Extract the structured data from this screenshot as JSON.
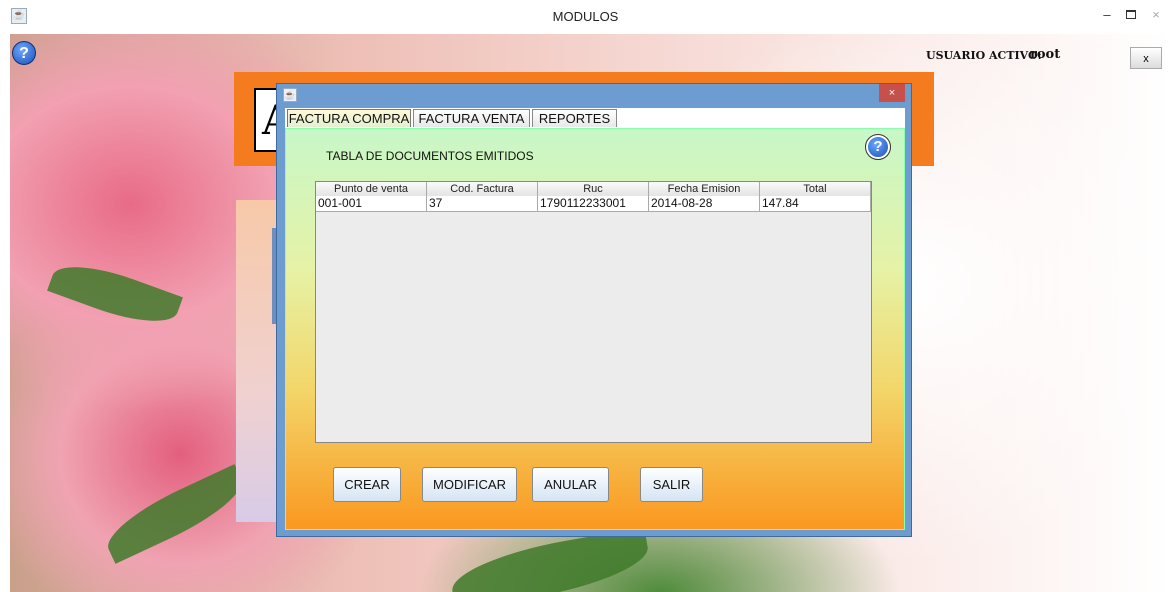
{
  "window": {
    "title": "MODULOS",
    "minimize": "–",
    "close": "×"
  },
  "header": {
    "user_label": "USUARIO ACTIVO:",
    "user_value": "root",
    "x_button": "x",
    "help": "?"
  },
  "logo_letter": "A",
  "dialog": {
    "close": "×",
    "tabs": [
      {
        "label": "FACTURA COMPRA",
        "active": true
      },
      {
        "label": "FACTURA VENTA",
        "active": false
      },
      {
        "label": "REPORTES",
        "active": false
      }
    ],
    "section_title": "TABLA DE DOCUMENTOS EMITIDOS",
    "help": "?",
    "table": {
      "columns": [
        "Punto de venta",
        "Cod. Factura",
        "Ruc",
        "Fecha Emision",
        "Total"
      ],
      "rows": [
        [
          "001-001",
          "37",
          "1790112233001",
          "2014-08-28",
          "147.84"
        ]
      ]
    },
    "buttons": {
      "crear": "CREAR",
      "modificar": "MODIFICAR",
      "anular": "ANULAR",
      "salir": "SALIR"
    }
  },
  "colors": {
    "orange": "#f47c1e",
    "dialog_blue": "#6d9dd0",
    "close_red": "#c7504a"
  }
}
